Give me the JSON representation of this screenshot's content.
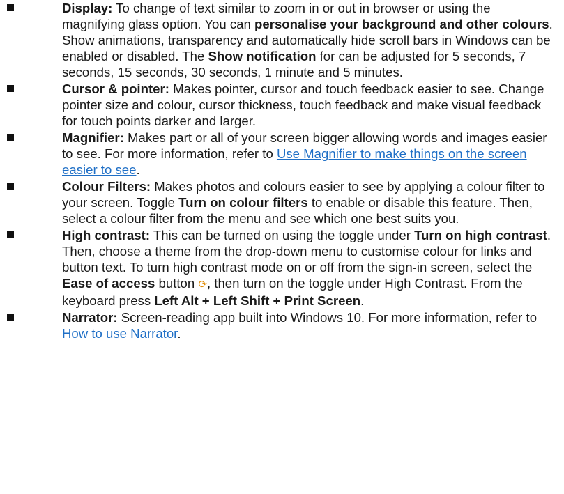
{
  "items": [
    {
      "id": "display",
      "parts": [
        {
          "t": "Display:",
          "s": "b"
        },
        {
          "t": " To change of text similar to zoom in or out in browser or using the magnifying glass option. You can "
        },
        {
          "t": "personalise your background and other colours",
          "s": "b"
        },
        {
          "t": ". Show animations, transparency and automatically hide scroll bars in Windows can be enabled or disabled. The "
        },
        {
          "t": "Show notification",
          "s": "b"
        },
        {
          "t": " for can be adjusted for 5 seconds, 7 seconds, 15 seconds, 30 seconds, 1 minute and 5 minutes."
        }
      ]
    },
    {
      "id": "cursor-pointer",
      "parts": [
        {
          "t": "Cursor & pointer:",
          "s": "b"
        },
        {
          "t": " Makes pointer, cursor and touch feedback easier to see. Change pointer size and colour, cursor thickness, touch feedback and make visual feedback for touch points darker and larger."
        }
      ]
    },
    {
      "id": "magnifier",
      "parts": [
        {
          "t": "Magnifier:",
          "s": "b"
        },
        {
          "t": " Makes part or all of your screen bigger allowing words and images easier to see. For more information, refer to "
        },
        {
          "t": "Use Magnifier to make things on the screen easier to see",
          "s": "link-u",
          "name": "magnifier-help-link"
        },
        {
          "t": "."
        }
      ]
    },
    {
      "id": "colour-filters",
      "parts": [
        {
          "t": "Colour Filters:",
          "s": "b"
        },
        {
          "t": " Makes photos and colours easier to see by applying a colour filter to your screen. Toggle "
        },
        {
          "t": "Turn on colour filters",
          "s": "b"
        },
        {
          "t": " to enable or disable this feature. Then, select a colour filter from the menu and see which one best suits you."
        }
      ]
    },
    {
      "id": "high-contrast",
      "parts": [
        {
          "t": "High contrast:",
          "s": "b"
        },
        {
          "t": " This can be turned on using the toggle under "
        },
        {
          "t": "Turn on high contrast",
          "s": "b"
        },
        {
          "t": ". Then, choose a theme from the drop-down menu to customise colour for links and button text. To turn high contrast mode on or off from the sign-in screen, select the "
        },
        {
          "t": "Ease of access",
          "s": "b"
        },
        {
          "t": " button "
        },
        {
          "t": "⟳",
          "s": "icon",
          "name": "ease-of-access-icon"
        },
        {
          "t": ", then turn on the toggle under High Contrast. From the keyboard press "
        },
        {
          "t": "Left Alt + Left Shift + Print Screen",
          "s": "b"
        },
        {
          "t": "."
        }
      ]
    },
    {
      "id": "narrator",
      "parts": [
        {
          "t": "Narrator:",
          "s": "b"
        },
        {
          "t": " Screen-reading app built into Windows 10. For more information, refer to "
        },
        {
          "t": "How to use Narrator",
          "s": "link",
          "name": "narrator-help-link"
        },
        {
          "t": "."
        }
      ]
    }
  ],
  "colors": {
    "text": "#1a1a1a",
    "link": "#1f6fc6",
    "bullet": "#111111",
    "icon": "#e08a00"
  },
  "icons": {
    "bullet": "black-square-bullet",
    "ease_of_access": "ease-of-access-icon"
  }
}
